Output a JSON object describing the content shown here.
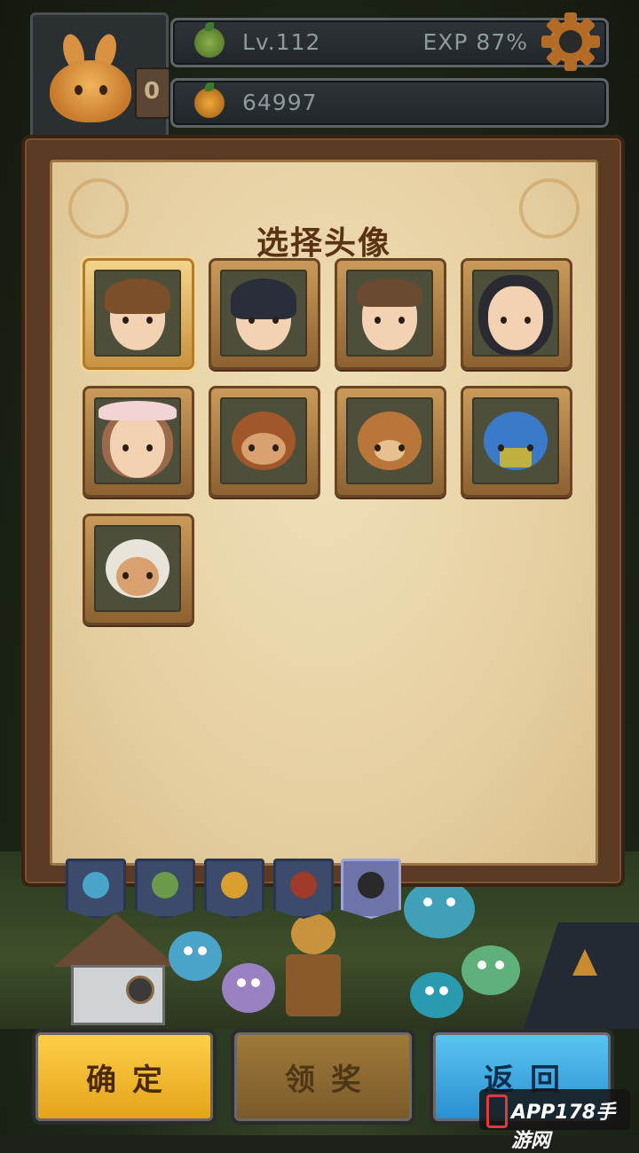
{
  "player": {
    "level_text": "Lv.112",
    "exp_text": "EXP 87%",
    "coins_text": "64997",
    "counter_digit": "0"
  },
  "panel": {
    "title": "选择头像",
    "avatars": [
      {
        "id": "brown-hair-man",
        "selected": true
      },
      {
        "id": "dark-hair-boy",
        "selected": false
      },
      {
        "id": "short-hair-boy",
        "selected": false
      },
      {
        "id": "glasses-girl",
        "selected": false
      },
      {
        "id": "bonnet-girl",
        "selected": false
      },
      {
        "id": "monkey",
        "selected": false
      },
      {
        "id": "bear",
        "selected": false
      },
      {
        "id": "luchador-mask",
        "selected": false
      },
      {
        "id": "turban-man",
        "selected": false
      }
    ]
  },
  "tabs": [
    {
      "icon": "blue-monster-icon",
      "active": false
    },
    {
      "icon": "green-monster-icon",
      "active": false
    },
    {
      "icon": "yellow-monster-icon",
      "active": false
    },
    {
      "icon": "red-monster-icon",
      "active": false
    },
    {
      "icon": "mystery-bomb-icon",
      "active": true
    }
  ],
  "buttons": {
    "confirm": "确定",
    "claim": "领奖",
    "back": "返回"
  },
  "watermark": {
    "text": "APP178手游网"
  },
  "colors": {
    "confirm": "#f2b830",
    "claim": "#8e6a30",
    "back": "#3aa8e4"
  }
}
